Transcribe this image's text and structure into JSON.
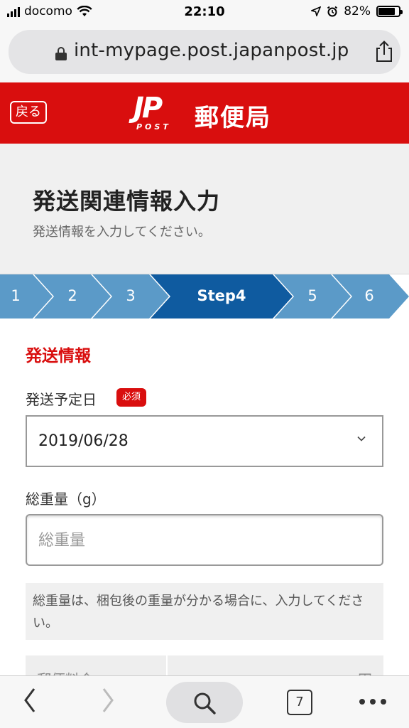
{
  "status_bar": {
    "carrier": "docomo",
    "time": "22:10",
    "battery": "82%",
    "battery_level": 0.82
  },
  "browser": {
    "url": "int-mypage.post.japanpost.jp",
    "tab_count": "7"
  },
  "header": {
    "back_label": "戻る",
    "logo_mark": "JP",
    "logo_sub": "POST",
    "logo_name": "郵便局",
    "color": "#d90e0e"
  },
  "page": {
    "title": "発送関連情報入力",
    "subtitle": "発送情報を入力してください。"
  },
  "steps": {
    "items": [
      {
        "label": "1",
        "active": false
      },
      {
        "label": "2",
        "active": false
      },
      {
        "label": "3",
        "active": false
      },
      {
        "label": "Step4",
        "active": true
      },
      {
        "label": "5",
        "active": false
      },
      {
        "label": "6",
        "active": false
      }
    ],
    "colors": {
      "inactive": "#5b9ac8",
      "active": "#0f5ba0"
    }
  },
  "form": {
    "section_title": "発送情報",
    "ship_date": {
      "label": "発送予定日",
      "required_badge": "必須",
      "value": "2019/06/28"
    },
    "weight": {
      "label": "総重量（g）",
      "placeholder": "総重量",
      "value": ""
    },
    "help_text": "総重量は、梱包後の重量が分かる場合に、入力してください。",
    "table_peek": {
      "left": "郵便料金",
      "right": "円"
    }
  }
}
